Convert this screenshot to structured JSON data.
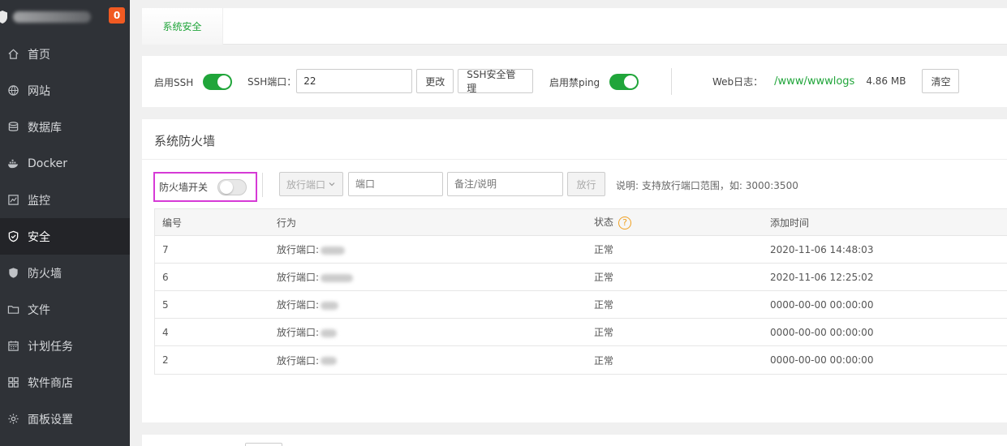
{
  "brand": {
    "badge": "0"
  },
  "sidebar": {
    "items": [
      {
        "label": "首页",
        "icon": "home-icon"
      },
      {
        "label": "网站",
        "icon": "globe-icon"
      },
      {
        "label": "数据库",
        "icon": "database-icon"
      },
      {
        "label": "Docker",
        "icon": "docker-icon"
      },
      {
        "label": "监控",
        "icon": "monitor-icon"
      },
      {
        "label": "安全",
        "icon": "shield-icon",
        "active": true
      },
      {
        "label": "防火墙",
        "icon": "firewall-icon"
      },
      {
        "label": "文件",
        "icon": "folder-icon"
      },
      {
        "label": "计划任务",
        "icon": "calendar-icon"
      },
      {
        "label": "软件商店",
        "icon": "apps-icon"
      },
      {
        "label": "面板设置",
        "icon": "gear-icon"
      }
    ]
  },
  "tabs": {
    "active": "系统安全"
  },
  "toolbar": {
    "ssh_label": "启用SSH",
    "ssh_port_label": "SSH端口：",
    "ssh_port_value": "22",
    "change_btn": "更改",
    "ssh_manage_btn": "SSH安全管理",
    "ping_label": "启用禁ping",
    "weblog_label": "Web日志：",
    "weblog_path": "/www/wwwlogs",
    "weblog_size": "4.86 MB",
    "clear_btn": "清空"
  },
  "firewall": {
    "title": "系统防火墙",
    "toggle_label": "防火墙开关",
    "type_select": "放行端口",
    "port_placeholder": "端口",
    "note_placeholder": "备注/说明",
    "allow_btn": "放行",
    "hint": "说明: 支持放行端口范围，如: 3000:3500",
    "columns": [
      "编号",
      "行为",
      "状态",
      "添加时间"
    ],
    "rows": [
      {
        "id": "7",
        "action": "放行端口:",
        "status": "正常",
        "time": "2020-11-06 14:48:03"
      },
      {
        "id": "6",
        "action": "放行端口:",
        "status": "正常",
        "time": "2020-11-06 12:25:02"
      },
      {
        "id": "5",
        "action": "放行端口:",
        "status": "正常",
        "time": "0000-00-00 00:00:00"
      },
      {
        "id": "4",
        "action": "放行端口:",
        "status": "正常",
        "time": "0000-00-00 00:00:00"
      },
      {
        "id": "2",
        "action": "放行端口:",
        "status": "正常",
        "time": "0000-00-00 00:00:00"
      }
    ]
  },
  "colors": {
    "accent": "#20a53a",
    "sidebar": "#2f3237",
    "badge": "#f15a22",
    "highlight": "#d63ad6"
  }
}
